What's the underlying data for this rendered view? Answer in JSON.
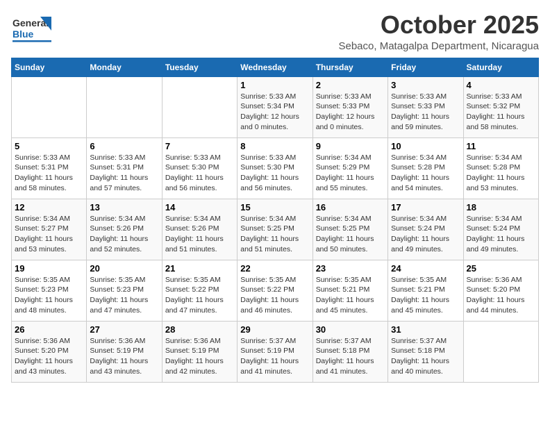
{
  "logo": {
    "text_general": "General",
    "text_blue": "Blue"
  },
  "header": {
    "month": "October 2025",
    "location": "Sebaco, Matagalpa Department, Nicaragua"
  },
  "days_of_week": [
    "Sunday",
    "Monday",
    "Tuesday",
    "Wednesday",
    "Thursday",
    "Friday",
    "Saturday"
  ],
  "weeks": [
    [
      {
        "day": "",
        "sunrise": "",
        "sunset": "",
        "daylight": ""
      },
      {
        "day": "",
        "sunrise": "",
        "sunset": "",
        "daylight": ""
      },
      {
        "day": "",
        "sunrise": "",
        "sunset": "",
        "daylight": ""
      },
      {
        "day": "1",
        "sunrise": "Sunrise: 5:33 AM",
        "sunset": "Sunset: 5:34 PM",
        "daylight": "Daylight: 12 hours and 0 minutes."
      },
      {
        "day": "2",
        "sunrise": "Sunrise: 5:33 AM",
        "sunset": "Sunset: 5:33 PM",
        "daylight": "Daylight: 12 hours and 0 minutes."
      },
      {
        "day": "3",
        "sunrise": "Sunrise: 5:33 AM",
        "sunset": "Sunset: 5:33 PM",
        "daylight": "Daylight: 11 hours and 59 minutes."
      },
      {
        "day": "4",
        "sunrise": "Sunrise: 5:33 AM",
        "sunset": "Sunset: 5:32 PM",
        "daylight": "Daylight: 11 hours and 58 minutes."
      }
    ],
    [
      {
        "day": "5",
        "sunrise": "Sunrise: 5:33 AM",
        "sunset": "Sunset: 5:31 PM",
        "daylight": "Daylight: 11 hours and 58 minutes."
      },
      {
        "day": "6",
        "sunrise": "Sunrise: 5:33 AM",
        "sunset": "Sunset: 5:31 PM",
        "daylight": "Daylight: 11 hours and 57 minutes."
      },
      {
        "day": "7",
        "sunrise": "Sunrise: 5:33 AM",
        "sunset": "Sunset: 5:30 PM",
        "daylight": "Daylight: 11 hours and 56 minutes."
      },
      {
        "day": "8",
        "sunrise": "Sunrise: 5:33 AM",
        "sunset": "Sunset: 5:30 PM",
        "daylight": "Daylight: 11 hours and 56 minutes."
      },
      {
        "day": "9",
        "sunrise": "Sunrise: 5:34 AM",
        "sunset": "Sunset: 5:29 PM",
        "daylight": "Daylight: 11 hours and 55 minutes."
      },
      {
        "day": "10",
        "sunrise": "Sunrise: 5:34 AM",
        "sunset": "Sunset: 5:28 PM",
        "daylight": "Daylight: 11 hours and 54 minutes."
      },
      {
        "day": "11",
        "sunrise": "Sunrise: 5:34 AM",
        "sunset": "Sunset: 5:28 PM",
        "daylight": "Daylight: 11 hours and 53 minutes."
      }
    ],
    [
      {
        "day": "12",
        "sunrise": "Sunrise: 5:34 AM",
        "sunset": "Sunset: 5:27 PM",
        "daylight": "Daylight: 11 hours and 53 minutes."
      },
      {
        "day": "13",
        "sunrise": "Sunrise: 5:34 AM",
        "sunset": "Sunset: 5:26 PM",
        "daylight": "Daylight: 11 hours and 52 minutes."
      },
      {
        "day": "14",
        "sunrise": "Sunrise: 5:34 AM",
        "sunset": "Sunset: 5:26 PM",
        "daylight": "Daylight: 11 hours and 51 minutes."
      },
      {
        "day": "15",
        "sunrise": "Sunrise: 5:34 AM",
        "sunset": "Sunset: 5:25 PM",
        "daylight": "Daylight: 11 hours and 51 minutes."
      },
      {
        "day": "16",
        "sunrise": "Sunrise: 5:34 AM",
        "sunset": "Sunset: 5:25 PM",
        "daylight": "Daylight: 11 hours and 50 minutes."
      },
      {
        "day": "17",
        "sunrise": "Sunrise: 5:34 AM",
        "sunset": "Sunset: 5:24 PM",
        "daylight": "Daylight: 11 hours and 49 minutes."
      },
      {
        "day": "18",
        "sunrise": "Sunrise: 5:34 AM",
        "sunset": "Sunset: 5:24 PM",
        "daylight": "Daylight: 11 hours and 49 minutes."
      }
    ],
    [
      {
        "day": "19",
        "sunrise": "Sunrise: 5:35 AM",
        "sunset": "Sunset: 5:23 PM",
        "daylight": "Daylight: 11 hours and 48 minutes."
      },
      {
        "day": "20",
        "sunrise": "Sunrise: 5:35 AM",
        "sunset": "Sunset: 5:23 PM",
        "daylight": "Daylight: 11 hours and 47 minutes."
      },
      {
        "day": "21",
        "sunrise": "Sunrise: 5:35 AM",
        "sunset": "Sunset: 5:22 PM",
        "daylight": "Daylight: 11 hours and 47 minutes."
      },
      {
        "day": "22",
        "sunrise": "Sunrise: 5:35 AM",
        "sunset": "Sunset: 5:22 PM",
        "daylight": "Daylight: 11 hours and 46 minutes."
      },
      {
        "day": "23",
        "sunrise": "Sunrise: 5:35 AM",
        "sunset": "Sunset: 5:21 PM",
        "daylight": "Daylight: 11 hours and 45 minutes."
      },
      {
        "day": "24",
        "sunrise": "Sunrise: 5:35 AM",
        "sunset": "Sunset: 5:21 PM",
        "daylight": "Daylight: 11 hours and 45 minutes."
      },
      {
        "day": "25",
        "sunrise": "Sunrise: 5:36 AM",
        "sunset": "Sunset: 5:20 PM",
        "daylight": "Daylight: 11 hours and 44 minutes."
      }
    ],
    [
      {
        "day": "26",
        "sunrise": "Sunrise: 5:36 AM",
        "sunset": "Sunset: 5:20 PM",
        "daylight": "Daylight: 11 hours and 43 minutes."
      },
      {
        "day": "27",
        "sunrise": "Sunrise: 5:36 AM",
        "sunset": "Sunset: 5:19 PM",
        "daylight": "Daylight: 11 hours and 43 minutes."
      },
      {
        "day": "28",
        "sunrise": "Sunrise: 5:36 AM",
        "sunset": "Sunset: 5:19 PM",
        "daylight": "Daylight: 11 hours and 42 minutes."
      },
      {
        "day": "29",
        "sunrise": "Sunrise: 5:37 AM",
        "sunset": "Sunset: 5:19 PM",
        "daylight": "Daylight: 11 hours and 41 minutes."
      },
      {
        "day": "30",
        "sunrise": "Sunrise: 5:37 AM",
        "sunset": "Sunset: 5:18 PM",
        "daylight": "Daylight: 11 hours and 41 minutes."
      },
      {
        "day": "31",
        "sunrise": "Sunrise: 5:37 AM",
        "sunset": "Sunset: 5:18 PM",
        "daylight": "Daylight: 11 hours and 40 minutes."
      },
      {
        "day": "",
        "sunrise": "",
        "sunset": "",
        "daylight": ""
      }
    ]
  ]
}
